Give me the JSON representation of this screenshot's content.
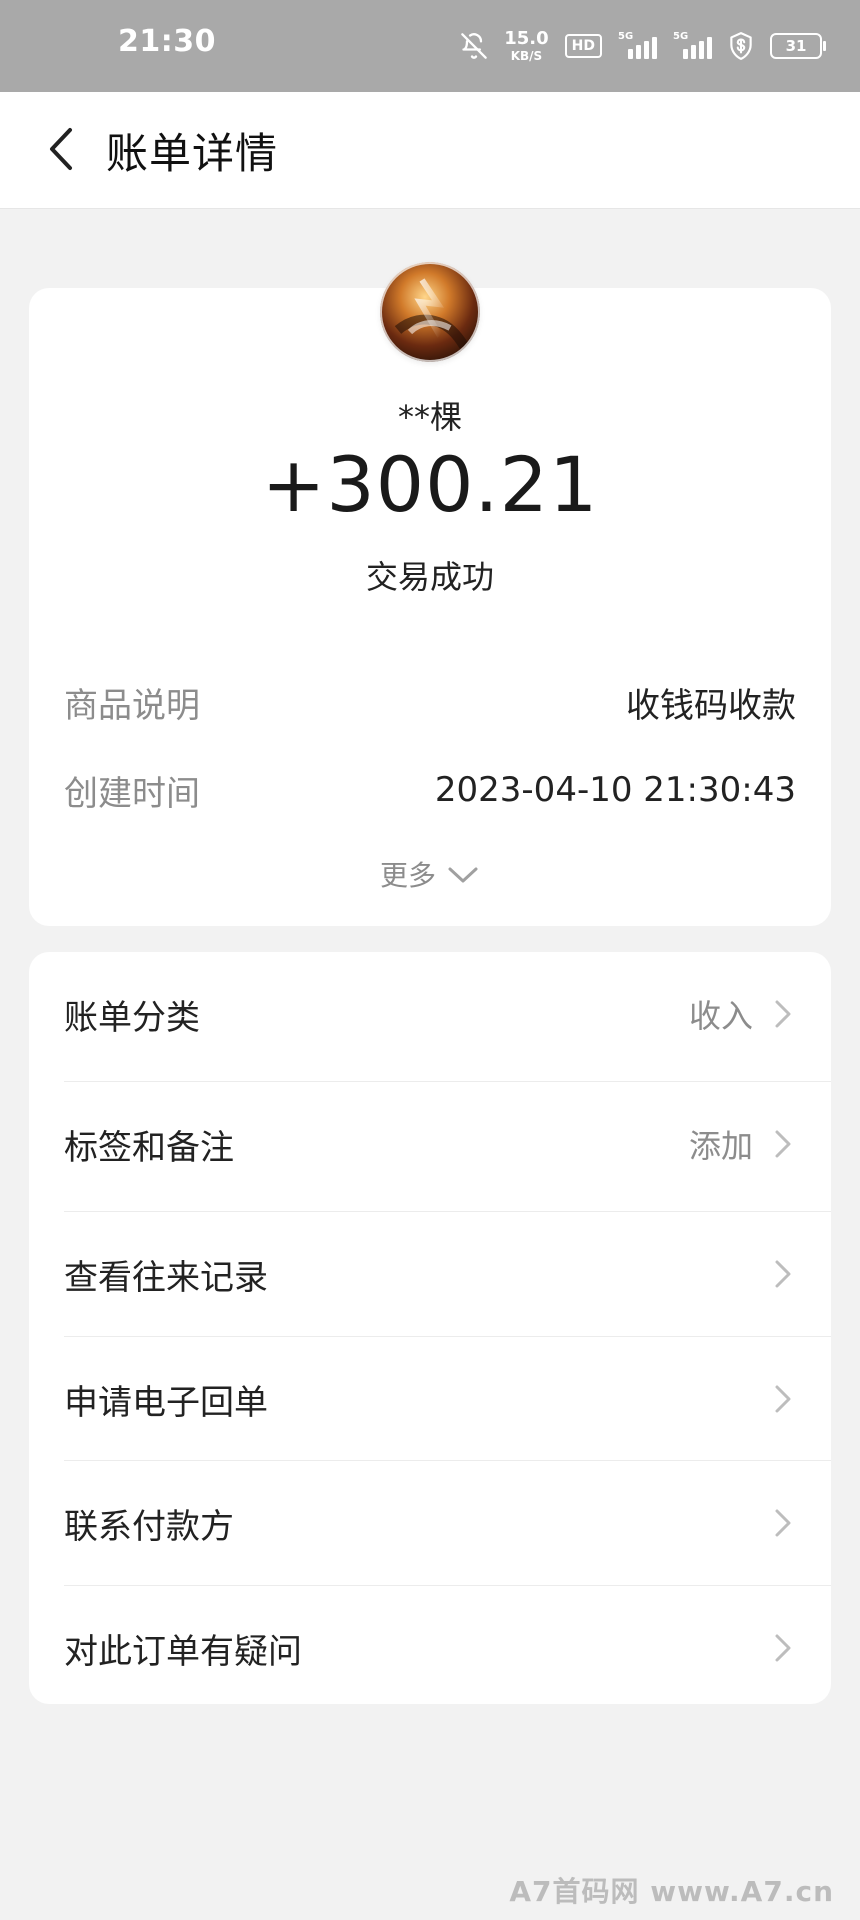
{
  "status_bar": {
    "time": "21:30",
    "net_speed_value": "15.0",
    "net_speed_unit": "KB/S",
    "hd_label": "HD",
    "sig1_label": "5G",
    "sig2_label": "5G",
    "battery_level": "31"
  },
  "header": {
    "title": "账单详情",
    "back_icon": "chevron-left-icon"
  },
  "summary": {
    "avatar_icon": "avatar-image",
    "payer": "**棵",
    "amount": "+300.21",
    "status": "交易成功",
    "rows": [
      {
        "label": "商品说明",
        "value": "收钱码收款"
      },
      {
        "label": "创建时间",
        "value": "2023-04-10 21:30:43"
      }
    ],
    "more_label": "更多"
  },
  "actions": [
    {
      "label": "账单分类",
      "value": "收入"
    },
    {
      "label": "标签和备注",
      "value": "添加"
    },
    {
      "label": "查看往来记录",
      "value": ""
    },
    {
      "label": "申请电子回单",
      "value": ""
    },
    {
      "label": "联系付款方",
      "value": ""
    },
    {
      "label": "对此订单有疑问",
      "value": ""
    }
  ],
  "watermark": "A7首码网 www.A7.cn",
  "colors": {
    "status_bar_bg": "#a9a9a9",
    "page_bg": "#f2f2f2",
    "card_bg": "#ffffff",
    "muted_text": "#8c8c8c"
  }
}
